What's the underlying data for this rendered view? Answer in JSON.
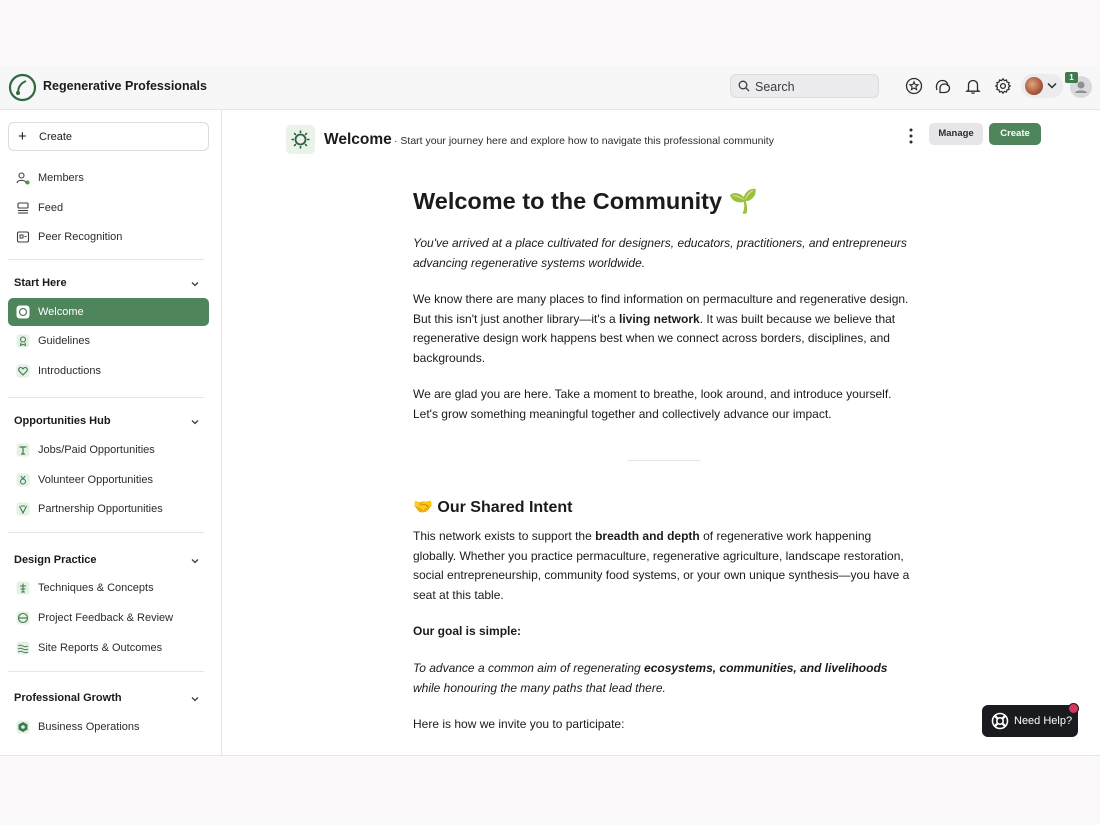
{
  "header": {
    "brand": "Regenerative Professionals",
    "search_placeholder": "Search",
    "notification_count": "1"
  },
  "sidebar": {
    "create_label": "Create",
    "top_items": [
      {
        "label": "Members",
        "icon": "members-icon"
      },
      {
        "label": "Feed",
        "icon": "feed-icon"
      },
      {
        "label": "Peer Recognition",
        "icon": "recognition-icon"
      }
    ],
    "sections": [
      {
        "title": "Start Here",
        "items": [
          {
            "label": "Welcome",
            "icon": "welcome-icon",
            "active": true
          },
          {
            "label": "Guidelines",
            "icon": "guidelines-icon"
          },
          {
            "label": "Introductions",
            "icon": "heart-icon"
          }
        ]
      },
      {
        "title": "Opportunities Hub",
        "items": [
          {
            "label": "Jobs/Paid Opportunities",
            "icon": "jobs-icon"
          },
          {
            "label": "Volunteer Opportunities",
            "icon": "volunteer-icon"
          },
          {
            "label": "Partnership Opportunities",
            "icon": "partnership-icon"
          }
        ]
      },
      {
        "title": "Design Practice",
        "items": [
          {
            "label": "Techniques & Concepts",
            "icon": "techniques-icon"
          },
          {
            "label": "Project Feedback & Review",
            "icon": "feedback-icon"
          },
          {
            "label": "Site Reports & Outcomes",
            "icon": "waves-icon"
          }
        ]
      },
      {
        "title": "Professional Growth",
        "items": [
          {
            "label": "Business Operations",
            "icon": "business-icon"
          }
        ]
      }
    ]
  },
  "space": {
    "title": "Welcome",
    "subtitle": "· Start your journey here and explore how to navigate this professional community",
    "manage_label": "Manage",
    "create_label": "Create"
  },
  "article": {
    "heading": "Welcome to the Community 🌱",
    "intro": "You've arrived at a place cultivated for designers, educators, practitioners, and entrepreneurs advancing regenerative systems worldwide.",
    "p1_a": "We know there are many places to find information on permaculture and regenerative design. But this isn't just another library—it's a ",
    "p1_bold": "living network",
    "p1_b": ". It was built because we believe that regenerative design work happens best when we connect across borders, disciplines, and backgrounds.",
    "p2": "We are glad you are here. Take a moment to breathe, look around, and introduce yourself. Let's grow something meaningful together and collectively advance our impact.",
    "intent_emoji": "🤝",
    "intent_heading": "Our Shared Intent",
    "p3_a": "This network exists to support the ",
    "p3_bold": "breadth and depth",
    "p3_b": " of regenerative work happening globally. Whether you practice permaculture, regenerative agriculture, landscape restoration, social entrepreneurship, community food systems, or your own unique synthesis—you have a seat at this table.",
    "goal_heading": "Our goal is simple:",
    "goal_a": "To advance a common aim of regenerating ",
    "goal_bold": "ecosystems, communities, and livelihoods",
    "goal_b": " while honouring the many paths that lead there.",
    "invite": "Here is how we invite you to participate:"
  },
  "help": {
    "label": "Need Help?"
  },
  "colors": {
    "accent": "#4e855a",
    "badge": "#3f7a4e",
    "alert": "#d8365b"
  }
}
